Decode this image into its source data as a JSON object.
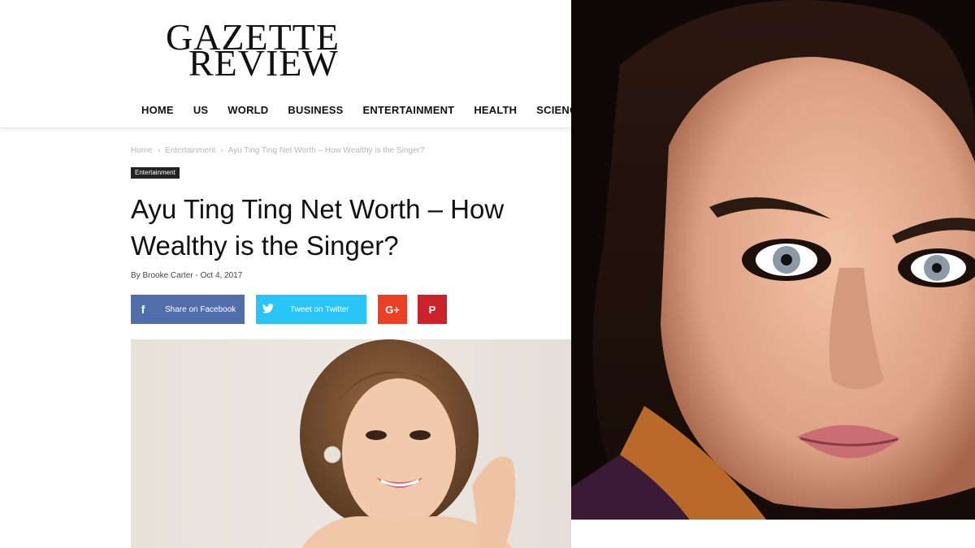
{
  "site": {
    "logo_line1": "GAZETTE",
    "logo_line2": "REVIEW"
  },
  "nav": {
    "items": [
      "HOME",
      "US",
      "WORLD",
      "BUSINESS",
      "ENTERTAINMENT",
      "HEALTH",
      "SCIENCE"
    ]
  },
  "breadcrumb": {
    "home": "Home",
    "section": "Entertainment",
    "current": "Ayu Ting Ting Net Worth – How Wealthy is the Singer?"
  },
  "article": {
    "category_tag": "Entertainment",
    "title_line1": "Ayu Ting Ting Net Worth – How",
    "title_line2": "Wealthy is the Singer?",
    "byline_prefix": "By",
    "author": "Brooke Carter",
    "byline_sep": "-",
    "date": "Oct 4, 2017"
  },
  "share": {
    "facebook_label": "Share on Facebook",
    "twitter_label": "Tweet on Twitter",
    "facebook_icon": "f",
    "twitter_icon": "🐦",
    "googleplus_icon": "G+",
    "pinterest_icon": "P"
  },
  "colors": {
    "facebook": "#516eab",
    "twitter": "#29c5f6",
    "googleplus": "#eb4026",
    "pinterest": "#ca212a",
    "tag_bg": "#222222"
  }
}
